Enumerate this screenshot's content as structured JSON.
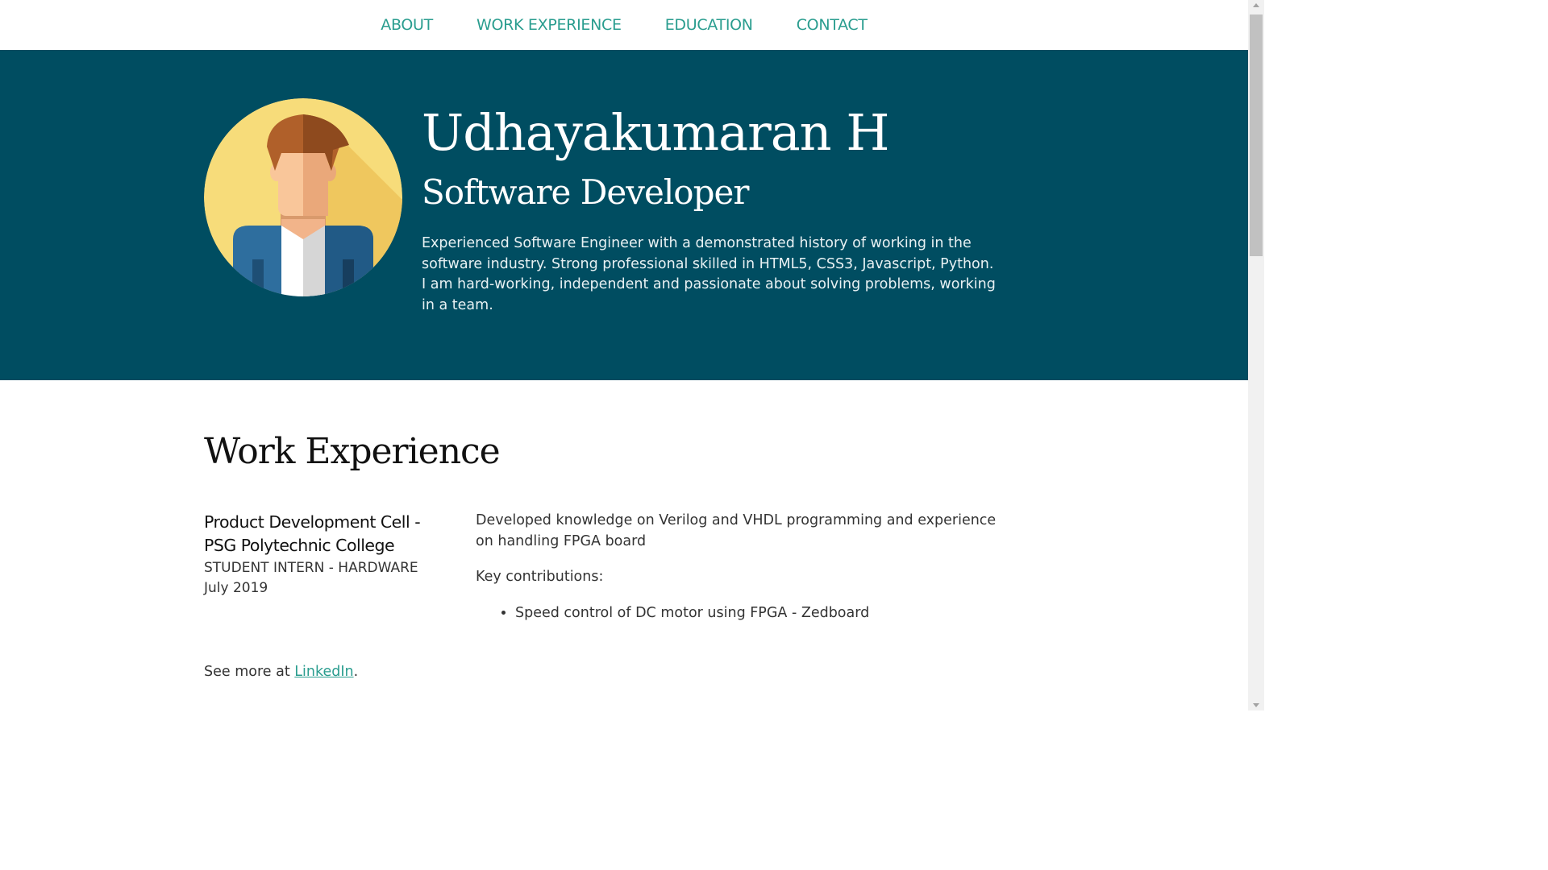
{
  "nav": {
    "items": [
      "ABOUT",
      "WORK EXPERIENCE",
      "EDUCATION",
      "CONTACT"
    ]
  },
  "hero": {
    "name": "Udhayakumaran H",
    "role": "Software Developer",
    "summary": "Experienced Software Engineer with a demonstrated history of working in the software industry. Strong professional skilled in HTML5, CSS3, Javascript, Python. I am hard-working, independent and passionate about solving problems, working in a team.",
    "avatar_icon": "person-avatar-icon"
  },
  "work": {
    "title": "Work Experience",
    "jobs": [
      {
        "company": "Product Development Cell - PSG Polytechnic College",
        "position": "STUDENT INTERN - HARDWARE",
        "date": "July 2019",
        "description": "Developed knowledge on Verilog and VHDL programming and experience on handling FPGA board",
        "contributions_label": "Key contributions:",
        "contributions": [
          "Speed control of DC motor using FPGA - Zedboard"
        ]
      }
    ],
    "see_more_prefix": "See more at ",
    "see_more_link": "LinkedIn",
    "see_more_suffix": "."
  },
  "colors": {
    "accent": "#2a9d8f",
    "hero_bg": "#004d61"
  }
}
